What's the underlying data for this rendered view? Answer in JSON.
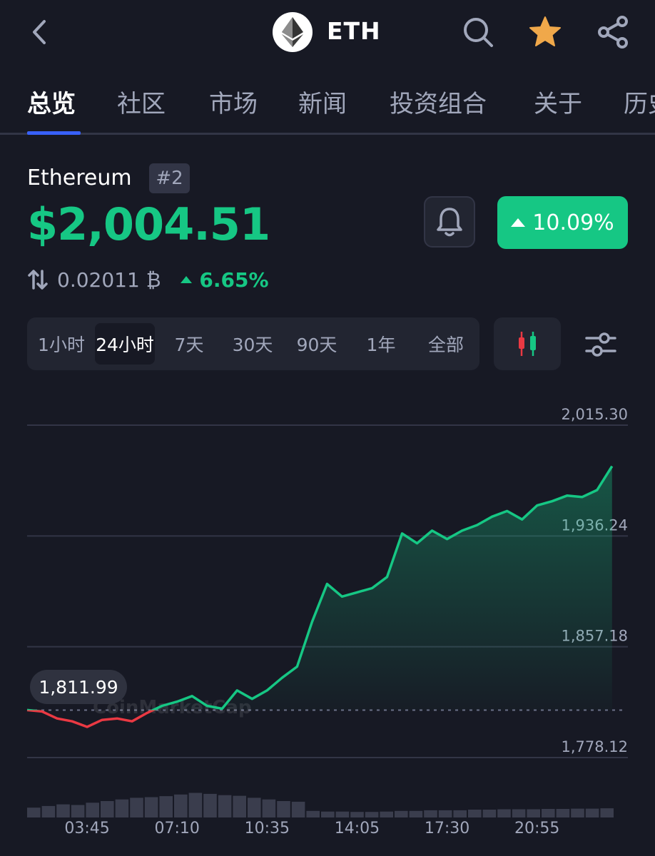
{
  "header": {
    "symbol": "ETH",
    "icons": [
      "chevron-left-icon",
      "ethereum-logo-icon",
      "search-icon",
      "star-icon",
      "share-icon"
    ],
    "star_color": "#f0a84a"
  },
  "tabs": [
    {
      "label": "总览",
      "active": true
    },
    {
      "label": "社区"
    },
    {
      "label": "市场"
    },
    {
      "label": "新闻"
    },
    {
      "label": "投资组合"
    },
    {
      "label": "关于"
    },
    {
      "label": "历史"
    }
  ],
  "coin": {
    "name": "Ethereum",
    "rank": "#2",
    "price": "$2,004.51",
    "change_24h": "10.09%",
    "btc_price": "0.02011 ₿",
    "btc_change": "6.65%"
  },
  "colors": {
    "background": "#171924",
    "up": "#16c784",
    "down": "#ea3943",
    "accent": "#3861fb",
    "muted": "#a1a7bb"
  },
  "ranges": [
    {
      "label": "1小时"
    },
    {
      "label": "24小时",
      "active": true
    },
    {
      "label": "7天"
    },
    {
      "label": "30天"
    },
    {
      "label": "90天"
    },
    {
      "label": "1年"
    },
    {
      "label": "全部"
    }
  ],
  "watermark": "CoinMarketCap",
  "chart_data": {
    "type": "line",
    "open_price": 1811.99,
    "open_label": "1,811.99",
    "ylim": [
      1778.12,
      2015.3
    ],
    "y_ticks": [
      {
        "value": 2015.3,
        "label": "2,015.30"
      },
      {
        "value": 1936.24,
        "label": "1,936.24"
      },
      {
        "value": 1857.18,
        "label": "1,857.18"
      },
      {
        "value": 1778.12,
        "label": "1,778.12"
      }
    ],
    "x_ticks": [
      "03:45",
      "07:10",
      "10:35",
      "14:05",
      "17:30",
      "20:55"
    ],
    "x_tick_positions": [
      2,
      5,
      8,
      11,
      14,
      17
    ],
    "xlim": [
      0,
      19.6
    ],
    "series": [
      {
        "x": [
          0,
          0.5,
          1,
          1.5,
          2,
          2.5,
          3,
          3.5,
          4,
          4.5,
          5,
          5.5,
          6,
          6.5,
          7,
          7.5,
          8,
          8.5,
          9,
          9.5,
          10,
          10.5,
          11,
          11.5,
          12,
          12.5,
          13,
          13.5,
          14,
          14.5,
          15,
          15.5,
          16,
          16.5,
          17,
          17.5,
          18,
          18.5,
          19,
          19.5
        ],
        "values": [
          1812,
          1811,
          1806,
          1804,
          1800,
          1805,
          1806,
          1804,
          1810,
          1815,
          1818,
          1822,
          1815,
          1813,
          1826,
          1820,
          1826,
          1835,
          1843,
          1875,
          1902,
          1893,
          1896,
          1899,
          1907,
          1938,
          1931,
          1940,
          1934,
          1940,
          1944,
          1950,
          1954,
          1948,
          1958,
          1961,
          1965,
          1964,
          1969,
          1986
        ],
        "volume": [
          0.3,
          0.35,
          0.4,
          0.38,
          0.45,
          0.5,
          0.55,
          0.6,
          0.62,
          0.65,
          0.7,
          0.75,
          0.72,
          0.68,
          0.66,
          0.6,
          0.55,
          0.5,
          0.48,
          0.2,
          0.18,
          0.18,
          0.17,
          0.17,
          0.18,
          0.2,
          0.2,
          0.22,
          0.22,
          0.22,
          0.24,
          0.24,
          0.25,
          0.25,
          0.25,
          0.26,
          0.26,
          0.27,
          0.27,
          0.28
        ]
      }
    ]
  }
}
